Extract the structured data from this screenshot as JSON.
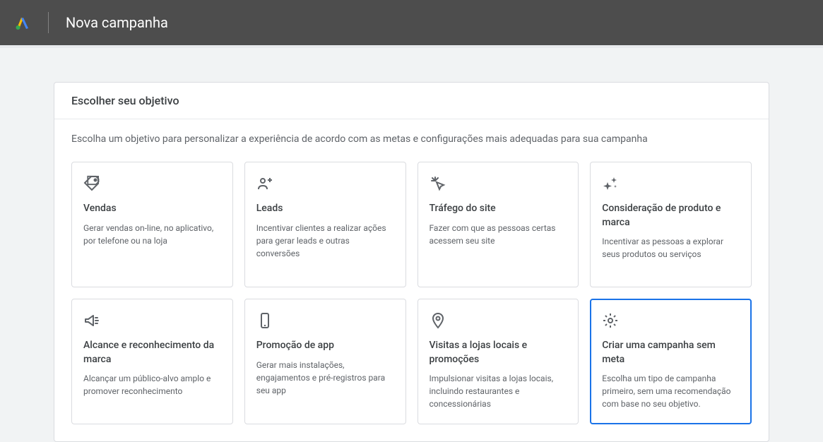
{
  "header": {
    "title": "Nova campanha"
  },
  "panel": {
    "title": "Escolher seu objetivo",
    "subtitle": "Escolha um objetivo para personalizar a experiência de acordo com as metas e configurações mais adequadas para sua campanha"
  },
  "cards": [
    {
      "title": "Vendas",
      "description": "Gerar vendas on-line, no aplicativo, por telefone ou na loja"
    },
    {
      "title": "Leads",
      "description": "Incentivar clientes a realizar ações para gerar leads e outras conversões"
    },
    {
      "title": "Tráfego do site",
      "description": "Fazer com que as pessoas certas acessem seu site"
    },
    {
      "title": "Consideração de produto e marca",
      "description": "Incentivar as pessoas a explorar seus produtos ou serviços"
    },
    {
      "title": "Alcance e reconhecimento da marca",
      "description": "Alcançar um público-alvo amplo e promover reconhecimento"
    },
    {
      "title": "Promoção de app",
      "description": "Gerar mais instalações, engajamentos e pré-registros para seu app"
    },
    {
      "title": "Visitas a lojas locais e promoções",
      "description": "Impulsionar visitas a lojas locais, incluindo restaurantes e concessionárias"
    },
    {
      "title": "Criar uma campanha sem meta",
      "description": "Escolha um tipo de campanha primeiro, sem uma recomendação com base no seu objetivo."
    }
  ]
}
